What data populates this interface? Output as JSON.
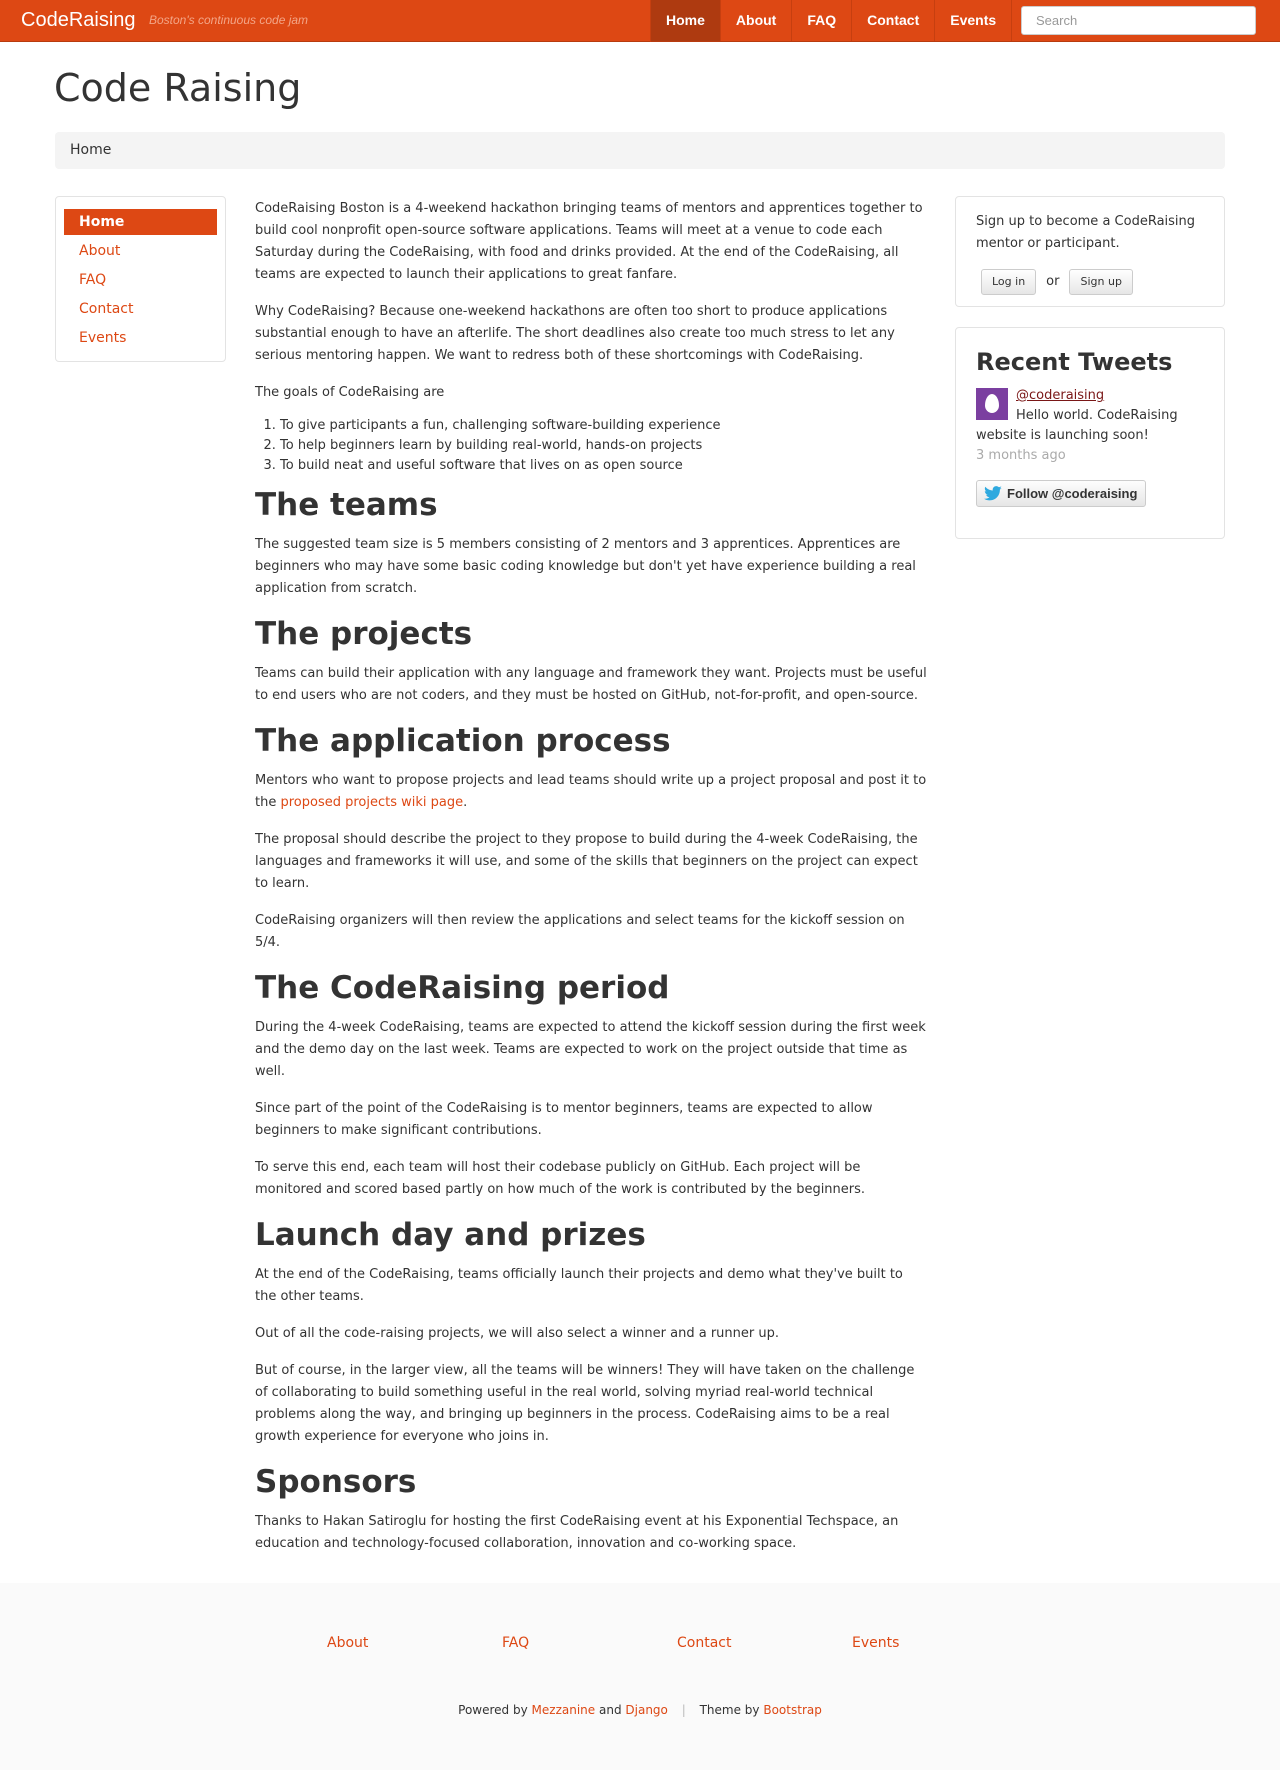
{
  "navbar": {
    "brand": "CodeRaising",
    "tagline": "Boston's continuous code jam",
    "items": [
      {
        "label": "Home",
        "active": true
      },
      {
        "label": "About",
        "active": false
      },
      {
        "label": "FAQ",
        "active": false
      },
      {
        "label": "Contact",
        "active": false
      },
      {
        "label": "Events",
        "active": false
      }
    ],
    "search_placeholder": "Search"
  },
  "page": {
    "title": "Code Raising",
    "breadcrumb": "Home"
  },
  "left_nav": {
    "items": [
      {
        "label": "Home",
        "active": true
      },
      {
        "label": "About",
        "active": false
      },
      {
        "label": "FAQ",
        "active": false
      },
      {
        "label": "Contact",
        "active": false
      },
      {
        "label": "Events",
        "active": false
      }
    ]
  },
  "content": {
    "intro_p1": "CodeRaising Boston is a 4-weekend hackathon bringing teams of mentors and apprentices together to build cool nonprofit open-source software applications. Teams will meet at a venue to code each Saturday during the CodeRaising, with food and drinks provided. At the end of the CodeRaising, all teams are expected to launch their applications to great fanfare.",
    "intro_p2": "Why CodeRaising? Because one-weekend hackathons are often too short to produce applications substantial enough to have an afterlife. The short deadlines also create too much stress to let any serious mentoring happen. We want to redress both of these shortcomings with CodeRaising.",
    "goals_intro": "The goals of CodeRaising are",
    "goals": [
      "To give participants a fun, challenging software-building experience",
      "To help beginners learn by building real-world, hands-on projects",
      "To build neat and useful software that lives on as open source"
    ],
    "teams_heading": "The teams",
    "teams_p1": "The suggested team size is 5 members consisting of 2 mentors and 3 apprentices. Apprentices are beginners who may have some basic coding knowledge but don't yet have experience building a real application from scratch.",
    "projects_heading": "The projects",
    "projects_p1": "Teams can build their application with any language and framework they want. Projects must be useful to end users who are not coders, and they must be hosted on GitHub, not-for-profit, and open-source.",
    "application_heading": "The application process",
    "application_p1_before": "Mentors who want to propose projects and lead teams should write up a project proposal and post it to the ",
    "application_p1_link": "proposed projects wiki page",
    "application_p1_after": ".",
    "application_p2": "The proposal should describe the project to they propose to build during the 4-week CodeRaising, the languages and frameworks it will use, and some of the skills that beginners on the project can expect to learn.",
    "application_p3": "CodeRaising organizers will then review the applications and select teams for the kickoff session on 5/4.",
    "period_heading": "The CodeRaising period",
    "period_p1": "During the 4-week CodeRaising, teams are expected to attend the kickoff session during the first week and the demo day on the last week. Teams are expected to work on the project outside that time as well.",
    "period_p2": "Since part of the point of the CodeRaising is to mentor beginners, teams are expected to allow beginners to make significant contributions.",
    "period_p3": "To serve this end, each team will host their codebase publicly on GitHub. Each project will be monitored and scored based partly on how much of the work is contributed by the beginners.",
    "launch_heading": "Launch day and prizes",
    "launch_p1": "At the end of the CodeRaising, teams officially launch their projects and demo what they've built to the other teams.",
    "launch_p2": "Out of all the code-raising projects, we will also select a winner and a runner up.",
    "launch_p3": "But of course, in the larger view, all the teams will be winners! They will have taken on the challenge of collaborating to build something useful in the real world, solving myriad real-world technical problems along the way, and bringing up beginners in the process. CodeRaising aims to be a real growth experience for everyone who joins in.",
    "sponsors_heading": "Sponsors",
    "sponsors_p1": "Thanks to Hakan Satiroglu for hosting the first CodeRaising event at his Exponential Techspace, an education and technology-focused collaboration, innovation and co-working space."
  },
  "signup": {
    "text": "Sign up to become a CodeRaising mentor or participant.",
    "login_label": "Log in",
    "or_label": "or",
    "signup_label": "Sign up"
  },
  "tweets": {
    "title": "Recent Tweets",
    "handle": "@coderaising",
    "text": "Hello world. CodeRaising website is launching soon!",
    "time": "3 months ago",
    "follow_label": "Follow @coderaising"
  },
  "footer": {
    "links": [
      "About",
      "FAQ",
      "Contact",
      "Events"
    ],
    "powered_by": "Powered by",
    "mezzanine": "Mezzanine",
    "and": "and",
    "django": "Django",
    "separator": "|",
    "theme_by": "Theme by",
    "bootstrap": "Bootstrap"
  },
  "colors": {
    "accent": "#dd4814",
    "navbar_active": "#ae3a10",
    "tweet_handle": "#7a1717"
  }
}
